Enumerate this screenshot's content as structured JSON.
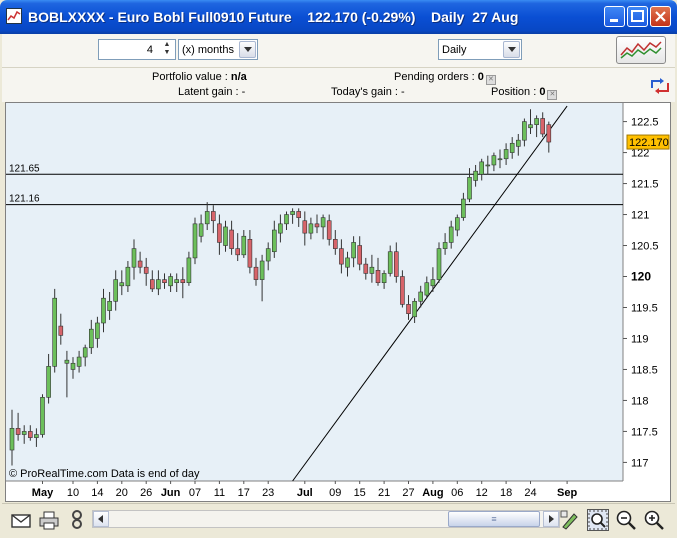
{
  "window": {
    "title": "BOBLXXXX - Euro Bobl Full0910 Future    122.170 (-0.29%)    Daily  27 Aug"
  },
  "toolbar": {
    "period_value": "4",
    "period_unit": "(x) months",
    "interval": "Daily"
  },
  "infobar": {
    "portfolio_label": "Portfolio value :",
    "portfolio_value": "n/a",
    "pending_label": "Pending orders :",
    "pending_value": "0",
    "latent_label": "Latent gain :",
    "latent_value": "-",
    "today_label": "Today's gain :",
    "today_value": "-",
    "position_label": "Position :",
    "position_value": "0"
  },
  "chart_data": {
    "type": "candlestick",
    "instrument": "BOBLXXXX",
    "last_price": "122.170",
    "y_ticks": [
      "117",
      "117.5",
      "118",
      "118.5",
      "119",
      "119.5",
      "120",
      "120.5",
      "121",
      "121.5",
      "122",
      "122.5"
    ],
    "bold_tick": "120",
    "ylim": [
      116.7,
      122.8
    ],
    "x_labels": [
      {
        "label": "May",
        "index": 5,
        "bold": true
      },
      {
        "label": "10",
        "index": 10
      },
      {
        "label": "14",
        "index": 14
      },
      {
        "label": "20",
        "index": 18
      },
      {
        "label": "26",
        "index": 22
      },
      {
        "label": "Jun",
        "index": 26,
        "bold": true
      },
      {
        "label": "07",
        "index": 30
      },
      {
        "label": "11",
        "index": 34
      },
      {
        "label": "17",
        "index": 38
      },
      {
        "label": "23",
        "index": 42
      },
      {
        "label": "Jul",
        "index": 48,
        "bold": true
      },
      {
        "label": "09",
        "index": 53
      },
      {
        "label": "15",
        "index": 57
      },
      {
        "label": "21",
        "index": 61
      },
      {
        "label": "27",
        "index": 65
      },
      {
        "label": "Aug",
        "index": 69,
        "bold": true
      },
      {
        "label": "06",
        "index": 73
      },
      {
        "label": "12",
        "index": 77
      },
      {
        "label": "18",
        "index": 81
      },
      {
        "label": "24",
        "index": 85
      },
      {
        "label": "Sep",
        "index": 91,
        "bold": true
      }
    ],
    "levels": [
      {
        "label": "121.65",
        "value": 121.65
      },
      {
        "label": "121.16",
        "value": 121.16
      }
    ],
    "trendline": [
      {
        "index": 46,
        "value": 116.7
      },
      {
        "index": 91,
        "value": 122.75
      }
    ],
    "footer": "© ProRealTime.com  Data is end of day",
    "candles": [
      [
        117.2,
        117.85,
        116.95,
        117.55
      ],
      [
        117.55,
        117.8,
        117.35,
        117.45
      ],
      [
        117.45,
        117.6,
        117.3,
        117.5
      ],
      [
        117.5,
        117.6,
        117.35,
        117.4
      ],
      [
        117.4,
        117.55,
        117.25,
        117.45
      ],
      [
        117.45,
        118.1,
        117.4,
        118.05
      ],
      [
        118.05,
        118.75,
        117.95,
        118.55
      ],
      [
        118.55,
        119.8,
        118.45,
        119.65
      ],
      [
        119.2,
        119.4,
        118.9,
        119.05
      ],
      [
        118.6,
        118.8,
        118.05,
        118.65
      ],
      [
        118.5,
        118.7,
        118.35,
        118.6
      ],
      [
        118.55,
        118.8,
        118.45,
        118.7
      ],
      [
        118.7,
        118.9,
        118.55,
        118.85
      ],
      [
        118.85,
        119.3,
        118.75,
        119.15
      ],
      [
        119.0,
        119.35,
        118.85,
        119.25
      ],
      [
        119.25,
        119.8,
        119.1,
        119.65
      ],
      [
        119.45,
        119.75,
        119.3,
        119.6
      ],
      [
        119.6,
        120.1,
        119.45,
        119.95
      ],
      [
        119.85,
        120.1,
        119.7,
        119.9
      ],
      [
        119.85,
        120.25,
        119.75,
        120.15
      ],
      [
        120.15,
        120.6,
        119.95,
        120.45
      ],
      [
        120.25,
        120.4,
        120.05,
        120.15
      ],
      [
        120.15,
        120.3,
        119.85,
        120.05
      ],
      [
        119.95,
        120.1,
        119.75,
        119.8
      ],
      [
        119.8,
        120.1,
        119.7,
        119.95
      ],
      [
        119.95,
        120.05,
        119.8,
        119.9
      ],
      [
        119.85,
        120.05,
        119.75,
        120.0
      ],
      [
        119.9,
        120.05,
        119.75,
        119.95
      ],
      [
        119.95,
        120.15,
        119.65,
        119.9
      ],
      [
        119.9,
        120.4,
        119.85,
        120.3
      ],
      [
        120.3,
        120.95,
        120.2,
        120.85
      ],
      [
        120.65,
        121.0,
        120.55,
        120.85
      ],
      [
        120.85,
        121.2,
        120.75,
        121.05
      ],
      [
        121.05,
        121.15,
        120.7,
        120.9
      ],
      [
        120.85,
        121.0,
        120.35,
        120.55
      ],
      [
        120.5,
        120.9,
        120.4,
        120.8
      ],
      [
        120.75,
        120.9,
        120.35,
        120.45
      ],
      [
        120.45,
        120.7,
        120.25,
        120.35
      ],
      [
        120.35,
        120.75,
        120.3,
        120.65
      ],
      [
        120.6,
        120.75,
        120.05,
        120.15
      ],
      [
        120.15,
        120.3,
        119.85,
        119.95
      ],
      [
        119.95,
        120.35,
        119.6,
        120.25
      ],
      [
        120.25,
        120.55,
        120.1,
        120.45
      ],
      [
        120.4,
        120.9,
        120.3,
        120.75
      ],
      [
        120.7,
        121.0,
        120.55,
        120.85
      ],
      [
        120.85,
        121.05,
        120.75,
        121.0
      ],
      [
        121.0,
        121.1,
        120.85,
        121.05
      ],
      [
        121.05,
        121.1,
        120.8,
        120.95
      ],
      [
        120.9,
        121.05,
        120.5,
        120.7
      ],
      [
        120.7,
        120.95,
        120.6,
        120.85
      ],
      [
        120.85,
        121.0,
        120.7,
        120.8
      ],
      [
        120.8,
        121.0,
        120.6,
        120.95
      ],
      [
        120.9,
        121.0,
        120.5,
        120.6
      ],
      [
        120.6,
        120.75,
        120.35,
        120.45
      ],
      [
        120.45,
        120.6,
        120.05,
        120.2
      ],
      [
        120.15,
        120.4,
        120.0,
        120.3
      ],
      [
        120.3,
        120.65,
        120.15,
        120.55
      ],
      [
        120.5,
        120.65,
        120.1,
        120.2
      ],
      [
        120.2,
        120.3,
        119.95,
        120.05
      ],
      [
        120.05,
        120.35,
        119.9,
        120.15
      ],
      [
        120.1,
        120.3,
        119.85,
        119.9
      ],
      [
        119.9,
        120.1,
        119.8,
        120.05
      ],
      [
        120.05,
        120.5,
        120.0,
        120.4
      ],
      [
        120.4,
        120.55,
        119.9,
        120.0
      ],
      [
        120.0,
        120.1,
        119.5,
        119.55
      ],
      [
        119.55,
        119.7,
        119.3,
        119.4
      ],
      [
        119.35,
        119.65,
        119.25,
        119.6
      ],
      [
        119.6,
        119.85,
        119.5,
        119.75
      ],
      [
        119.7,
        120.0,
        119.65,
        119.9
      ],
      [
        119.85,
        120.15,
        119.75,
        119.95
      ],
      [
        119.95,
        120.55,
        119.9,
        120.45
      ],
      [
        120.45,
        120.7,
        120.35,
        120.55
      ],
      [
        120.55,
        120.9,
        120.45,
        120.8
      ],
      [
        120.75,
        121.0,
        120.65,
        120.95
      ],
      [
        120.95,
        121.35,
        120.9,
        121.25
      ],
      [
        121.25,
        121.75,
        121.2,
        121.6
      ],
      [
        121.55,
        121.8,
        121.45,
        121.7
      ],
      [
        121.65,
        121.9,
        121.55,
        121.85
      ],
      [
        121.8,
        121.95,
        121.65,
        121.8
      ],
      [
        121.8,
        122.0,
        121.7,
        121.95
      ],
      [
        121.9,
        122.05,
        121.75,
        121.9
      ],
      [
        121.9,
        122.15,
        121.8,
        122.05
      ],
      [
        122.0,
        122.25,
        121.9,
        122.15
      ],
      [
        122.1,
        122.3,
        121.95,
        122.2
      ],
      [
        122.2,
        122.55,
        122.1,
        122.5
      ],
      [
        122.4,
        122.7,
        122.3,
        122.45
      ],
      [
        122.45,
        122.6,
        122.25,
        122.55
      ],
      [
        122.55,
        122.65,
        122.25,
        122.3
      ],
      [
        122.45,
        122.5,
        122.0,
        122.17
      ]
    ]
  }
}
